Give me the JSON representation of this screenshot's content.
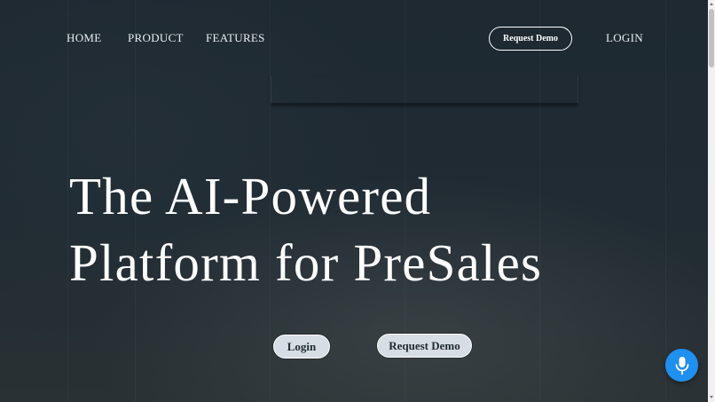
{
  "nav": {
    "home_label": "HOME",
    "product_label": "PRODUCT",
    "features_label": "FEATURES",
    "request_demo_label": "Request Demo",
    "login_label": "LOGIN"
  },
  "hero": {
    "title_line1": "The AI-Powered",
    "title_line2": "Platform for PreSales",
    "login_label": "Login",
    "request_demo_label": "Request Demo"
  },
  "widgets": {
    "mic_icon": "microphone-icon",
    "mic_color": "#1f8ff0"
  },
  "colors": {
    "background": "#1f2a32",
    "button_fill": "#d6dde4",
    "text": "#ffffff"
  }
}
